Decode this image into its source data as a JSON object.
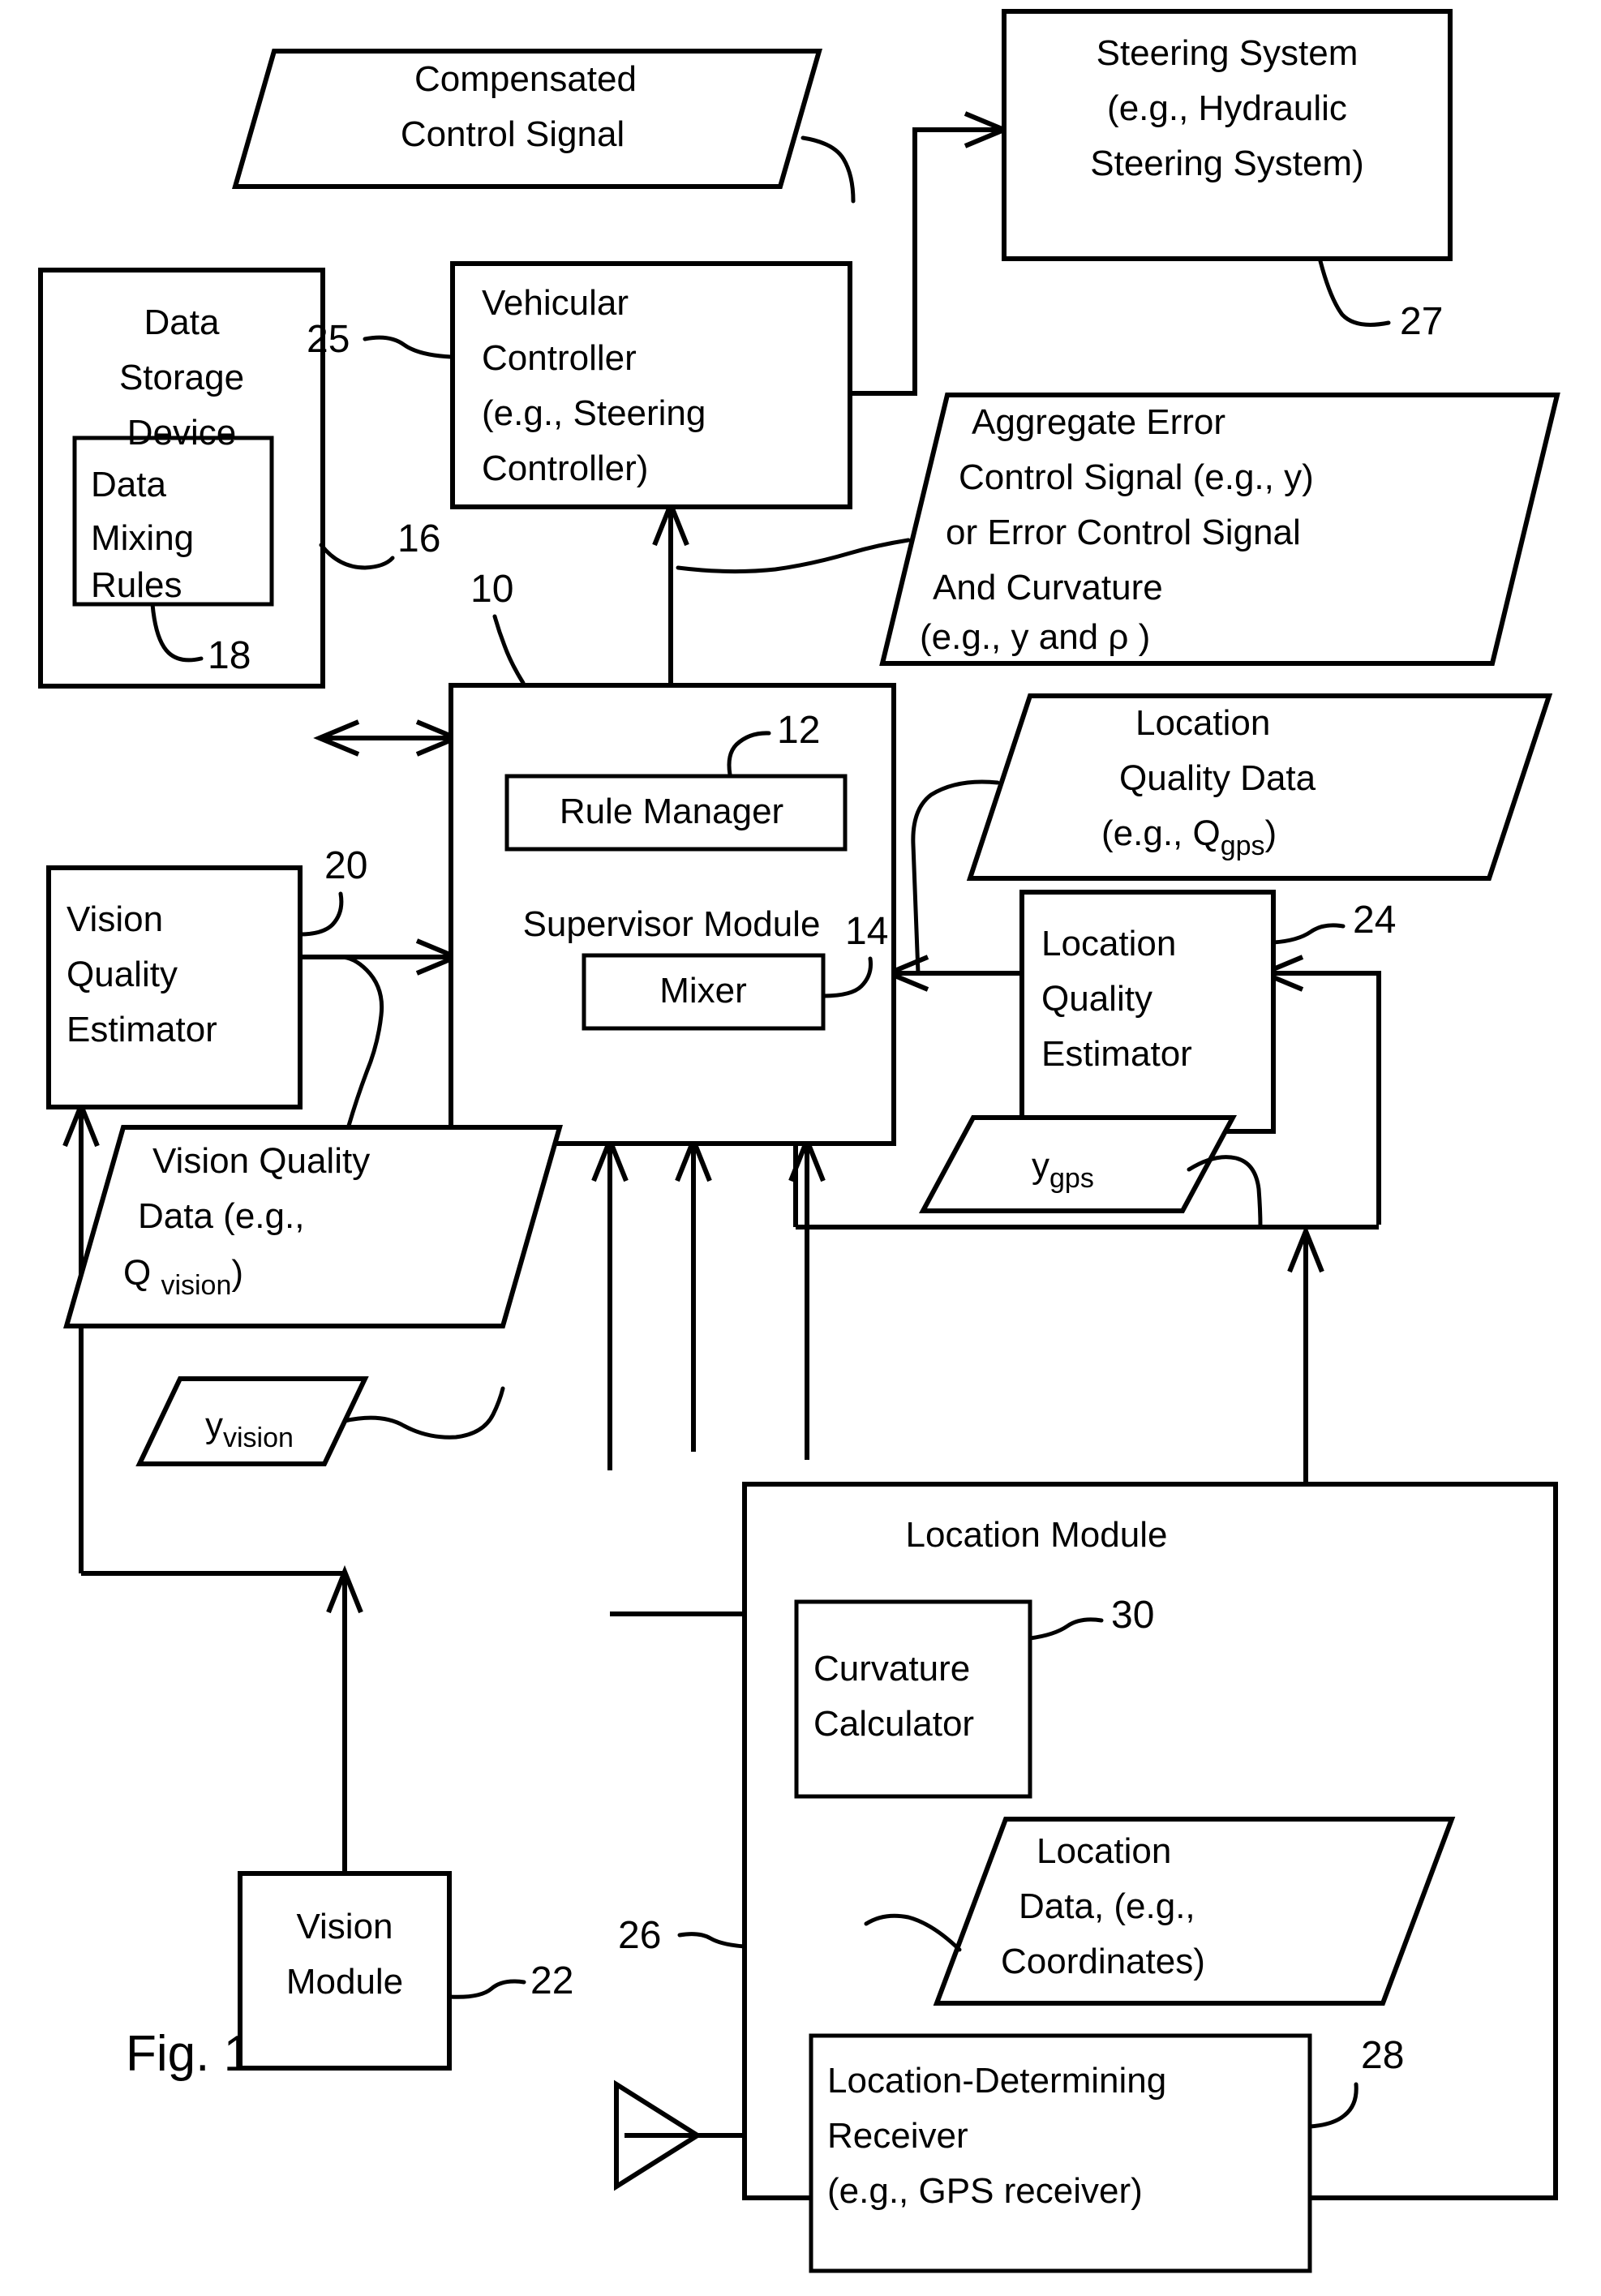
{
  "figure": {
    "caption": "Fig. 1"
  },
  "blocks": {
    "steering_system": {
      "lines": [
        "Steering System",
        "(e.g., Hydraulic",
        "Steering System)"
      ],
      "ref": "27"
    },
    "vehicular_controller": {
      "lines": [
        "Vehicular",
        "Controller",
        "(e.g., Steering",
        "Controller)"
      ],
      "ref": "25"
    },
    "data_storage_device": {
      "lines": [
        "Data",
        "Storage",
        "Device"
      ],
      "ref": "16"
    },
    "data_mixing_rules": {
      "lines": [
        "Data",
        "Mixing",
        "Rules"
      ],
      "ref": "18"
    },
    "supervisor_module": {
      "label": "Supervisor Module",
      "ref": "10"
    },
    "rule_manager": {
      "label": "Rule Manager",
      "ref": "12"
    },
    "mixer": {
      "label": "Mixer",
      "ref": "14"
    },
    "vision_quality_estimator": {
      "lines": [
        "Vision",
        "Quality",
        "Estimator"
      ],
      "ref": "20"
    },
    "vision_module": {
      "lines": [
        "Vision",
        "Module"
      ],
      "ref": "22"
    },
    "location_quality_estimator": {
      "lines": [
        "Location",
        "Quality",
        "Estimator"
      ],
      "ref": "24"
    },
    "location_module": {
      "label": "Location Module",
      "ref": "26"
    },
    "curvature_calculator": {
      "lines": [
        "Curvature",
        "Calculator"
      ],
      "ref": "30"
    },
    "location_determining_receiver": {
      "lines": [
        "Location-Determining",
        "Receiver",
        "(e.g., GPS receiver)"
      ],
      "ref": "28"
    }
  },
  "data_shapes": {
    "compensated_control_signal": {
      "lines": [
        "Compensated",
        "Control Signal"
      ]
    },
    "aggregate_error_control_signal": {
      "lines": [
        "Aggregate Error",
        "Control Signal (e.g., y)",
        "or Error Control Signal",
        "And Curvature",
        "(e.g., y and ρ )"
      ]
    },
    "location_quality_data": {
      "lines": [
        "Location",
        "Quality Data"
      ],
      "formula_prefix": "(e.g., Q",
      "formula_sub": "gps",
      "formula_suffix": ")"
    },
    "vision_quality_data": {
      "lines": [
        "Vision Quality",
        "Data (e.g.,"
      ],
      "formula_prefix": "Q ",
      "formula_sub": "vision",
      "formula_suffix": ")"
    },
    "y_vision": {
      "symbol": "y",
      "subscript": "vision"
    },
    "y_gps": {
      "symbol": "y",
      "subscript": "gps"
    },
    "location_data": {
      "lines": [
        "Location",
        "Data, (e.g.,",
        "Coordinates)"
      ]
    }
  },
  "icons": {
    "antenna": "antenna-icon"
  }
}
